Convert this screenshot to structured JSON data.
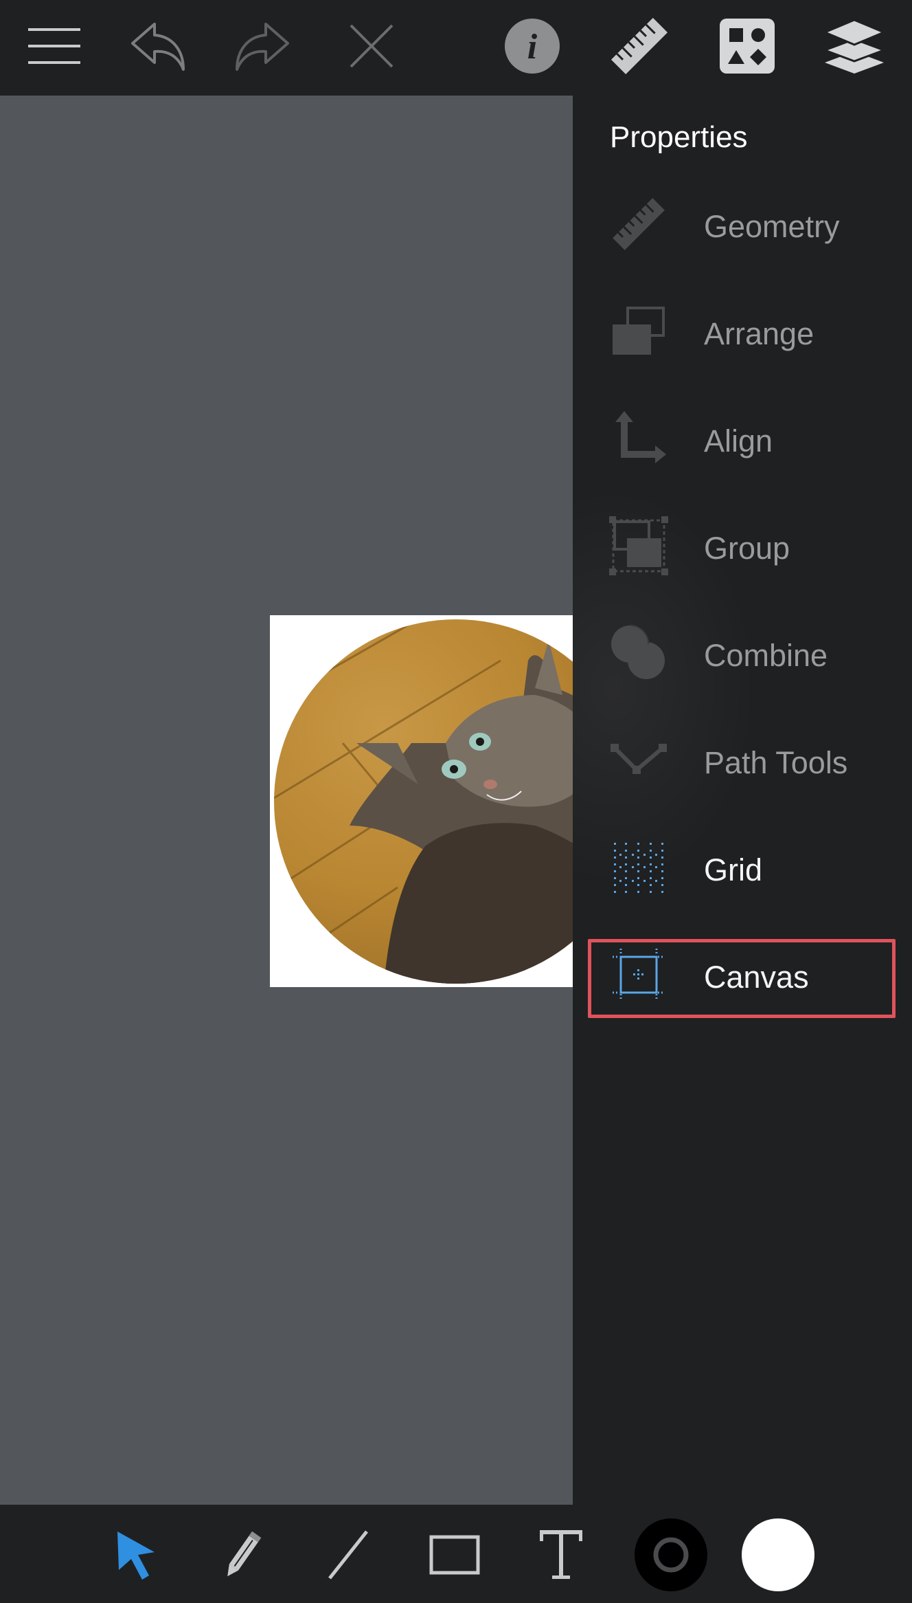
{
  "toolbar": {
    "menu_icon": "hamburger-menu-icon",
    "undo_icon": "undo-arrow-icon",
    "redo_icon": "redo-arrow-icon",
    "delete_icon": "close-x-icon",
    "info_icon": "info-icon",
    "properties_icon": "ruler-icon",
    "shapes_icon": "shapes-library-icon",
    "layers_icon": "layers-icon"
  },
  "canvas": {
    "background_color": "#53575b",
    "artboard_color": "#ffffff",
    "image": "cat-photo-circle"
  },
  "panel": {
    "title": "Properties",
    "items": [
      {
        "label": "Geometry",
        "icon": "ruler-icon",
        "active": false
      },
      {
        "label": "Arrange",
        "icon": "arrange-icon",
        "active": false
      },
      {
        "label": "Align",
        "icon": "align-icon",
        "active": false
      },
      {
        "label": "Group",
        "icon": "group-icon",
        "active": false
      },
      {
        "label": "Combine",
        "icon": "combine-icon",
        "active": false
      },
      {
        "label": "Path Tools",
        "icon": "path-tools-icon",
        "active": false
      },
      {
        "label": "Grid",
        "icon": "grid-icon",
        "active": true
      },
      {
        "label": "Canvas",
        "icon": "canvas-icon",
        "active": true,
        "highlighted": true
      }
    ],
    "highlight_color": "#e0535b"
  },
  "bottom_toolbar": {
    "tools": [
      {
        "name": "select-tool",
        "icon": "pointer-arrow-icon",
        "active": true,
        "color": "#2f8fe0"
      },
      {
        "name": "pencil-tool",
        "icon": "pencil-icon",
        "active": false
      },
      {
        "name": "line-tool",
        "icon": "line-icon",
        "active": false
      },
      {
        "name": "rectangle-tool",
        "icon": "rectangle-icon",
        "active": false
      },
      {
        "name": "text-tool",
        "icon": "text-icon",
        "active": false
      },
      {
        "name": "stroke-color",
        "icon": "stroke-swatch-icon",
        "color": "#000000"
      },
      {
        "name": "fill-color",
        "icon": "fill-swatch-icon",
        "color": "#ffffff"
      }
    ]
  }
}
